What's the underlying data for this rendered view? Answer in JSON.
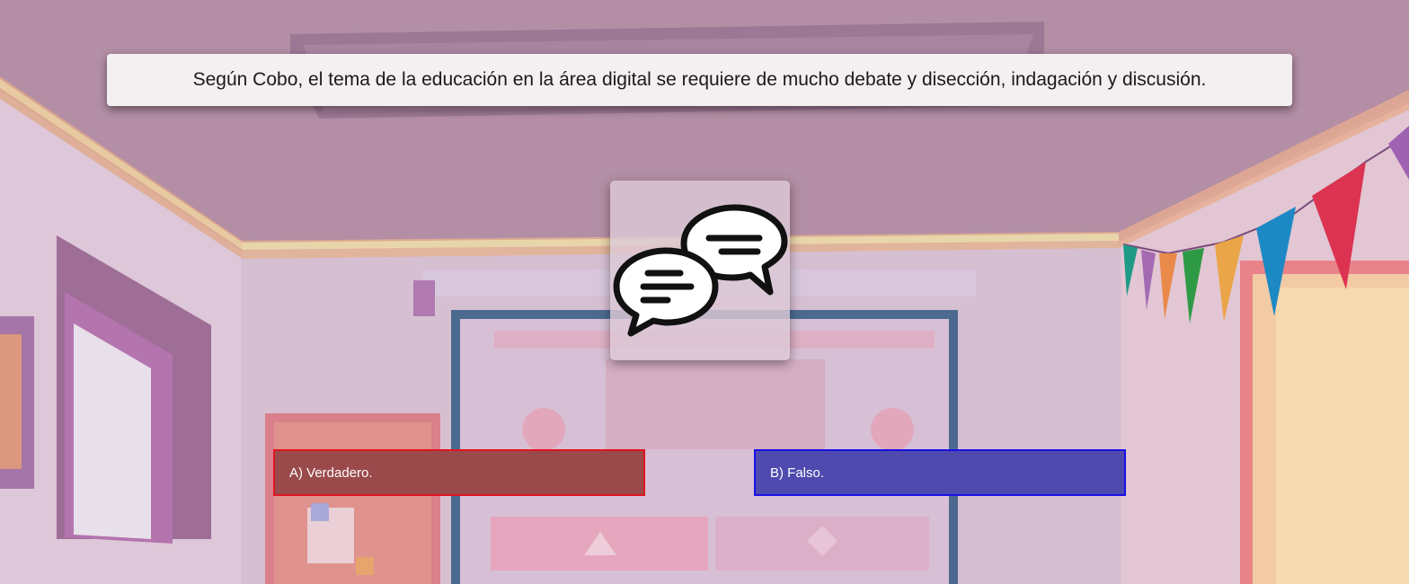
{
  "question": {
    "text": "Según Cobo, el tema de la educación en la área digital se requiere de mucho debate y disección, indagación y discusión."
  },
  "illustration": {
    "icon": "speech-bubbles-icon"
  },
  "answers": [
    {
      "label": "A) Verdadero.",
      "color": "#9b4a4c",
      "border": "#e0141e"
    },
    {
      "label": "B) Falso.",
      "color": "#4f4aae",
      "border": "#1a10e6"
    }
  ],
  "background": {
    "scene": "classroom-illustration",
    "tint": "#b693a8"
  }
}
